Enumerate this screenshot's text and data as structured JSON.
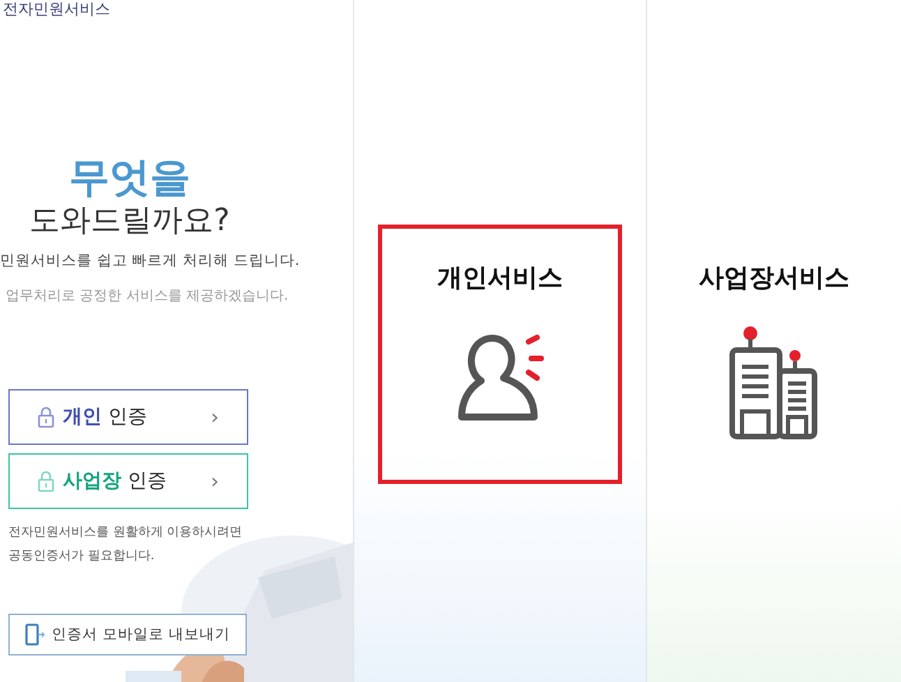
{
  "header": {
    "title": "전자민원서비스"
  },
  "hero": {
    "headline": "무엇을",
    "subheadline": "도와드릴까요?",
    "lines": [
      "민원서비스를 쉽고 빠르게 처리해 드립니다.",
      "업무처리로 공정한 서비스를 제공하겠습니다."
    ]
  },
  "auth_buttons": [
    {
      "kind": "personal",
      "highlight": "개인",
      "label": "인증",
      "chevron": "›"
    },
    {
      "kind": "business",
      "highlight": "사업장",
      "label": "인증",
      "chevron": "›"
    }
  ],
  "notice": "전자민원서비스를 원활하게 이용하시려면 공동인증서가 필요합니다.",
  "export_button": {
    "label": "인증서 모바일로 내보내기"
  },
  "services": [
    {
      "kind": "person",
      "title": "개인서비스",
      "selected": true
    },
    {
      "kind": "building",
      "title": "사업장서비스",
      "selected": false
    }
  ]
}
